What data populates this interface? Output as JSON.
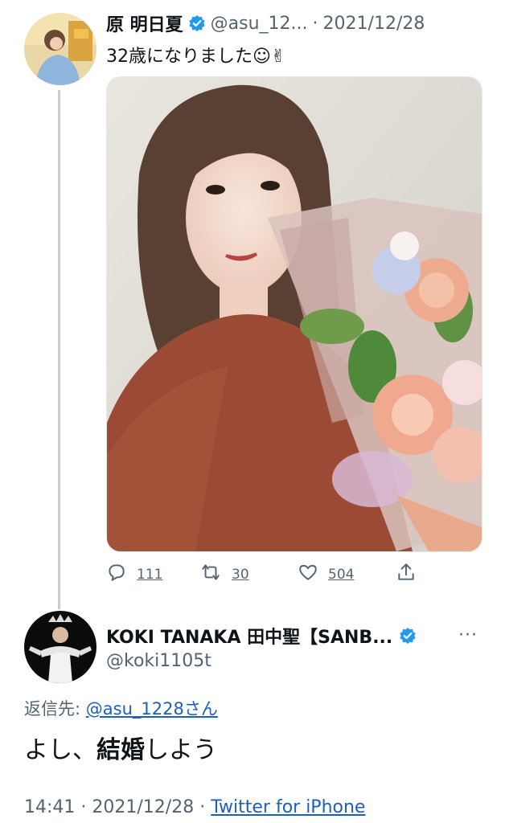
{
  "original_tweet": {
    "display_name": "原 明日夏",
    "handle": "@asu_12...",
    "separator": "·",
    "date": "2021/12/28",
    "text": "32歳になりました☺✌",
    "stats": {
      "replies": "111",
      "retweets": "30",
      "likes": "504"
    }
  },
  "reply_tweet": {
    "display_name": "KOKI TANAKA 田中聖【SANB...",
    "handle": "@koki1105t",
    "reply_to_prefix": "返信先:",
    "reply_to_user": "@asu_1228さん",
    "text_before": "よし、",
    "text_bold": "結婚",
    "text_after": "しよう",
    "time": "14:41",
    "separator": "·",
    "date": "2021/12/28",
    "source": "Twitter for iPhone"
  },
  "more_label": "···",
  "colors": {
    "verified_blue": "#1d9bf0",
    "link_blue": "#1d5fbf",
    "secondary_text": "#536471"
  },
  "icons": [
    "verified-badge-icon",
    "reply-icon",
    "retweet-icon",
    "like-icon",
    "share-icon",
    "more-icon"
  ]
}
